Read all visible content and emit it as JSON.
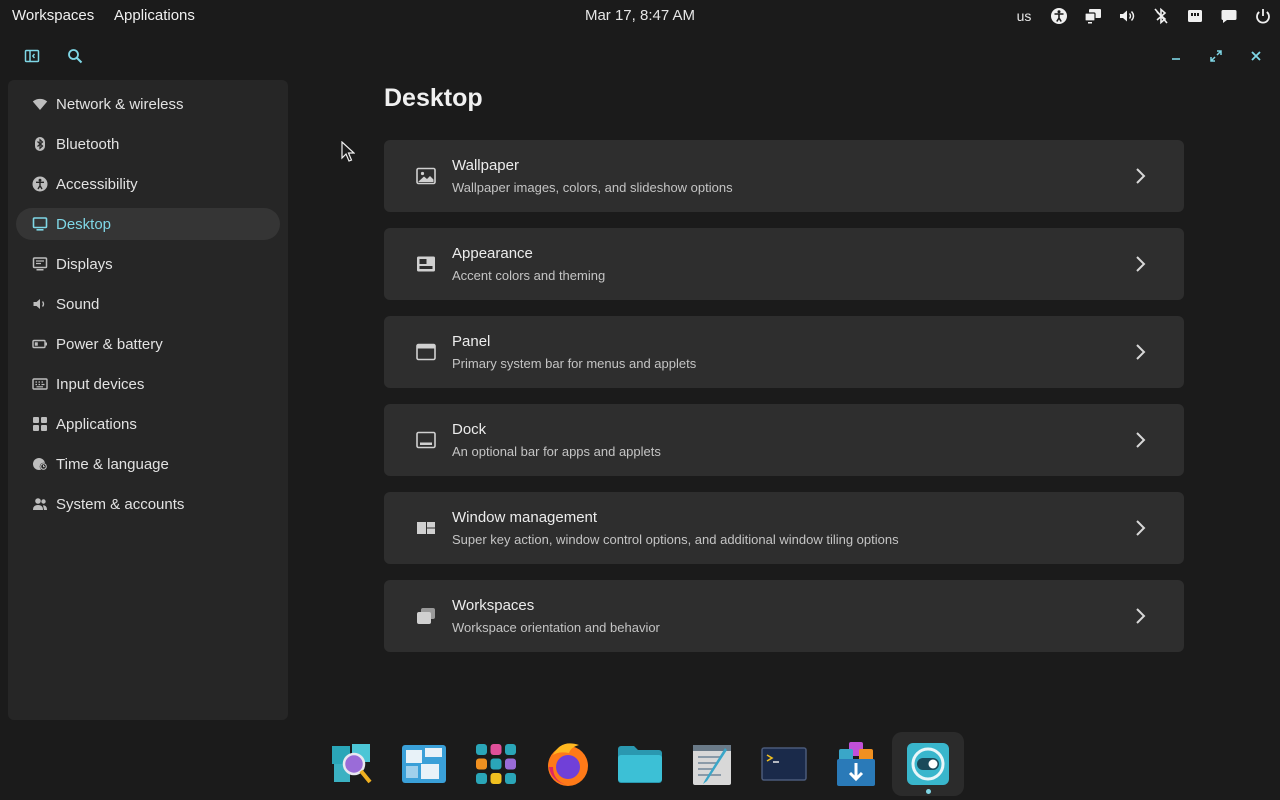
{
  "topbar": {
    "workspaces": "Workspaces",
    "applications": "Applications",
    "clock": "Mar 17, 8:47 AM",
    "keyboard_layout": "us",
    "tray_icons": [
      "accessibility-icon",
      "displays-icon",
      "volume-icon",
      "bluetooth-off-icon",
      "network-icon",
      "notifications-icon",
      "power-icon"
    ]
  },
  "sidebar": {
    "items": [
      {
        "label": "Network & wireless",
        "icon": "wifi-icon"
      },
      {
        "label": "Bluetooth",
        "icon": "bluetooth-icon"
      },
      {
        "label": "Accessibility",
        "icon": "accessibility-icon"
      },
      {
        "label": "Desktop",
        "icon": "desktop-icon",
        "active": true
      },
      {
        "label": "Displays",
        "icon": "display-icon"
      },
      {
        "label": "Sound",
        "icon": "speaker-icon"
      },
      {
        "label": "Power & battery",
        "icon": "battery-icon"
      },
      {
        "label": "Input devices",
        "icon": "keyboard-icon"
      },
      {
        "label": "Applications",
        "icon": "apps-grid-icon"
      },
      {
        "label": "Time & language",
        "icon": "globe-clock-icon"
      },
      {
        "label": "System & accounts",
        "icon": "users-icon"
      }
    ]
  },
  "main": {
    "title": "Desktop",
    "cards": [
      {
        "title": "Wallpaper",
        "desc": "Wallpaper images, colors, and slideshow options",
        "icon": "image-icon"
      },
      {
        "title": "Appearance",
        "desc": "Accent colors and theming",
        "icon": "appearance-icon"
      },
      {
        "title": "Panel",
        "desc": "Primary system bar for menus and applets",
        "icon": "panel-icon"
      },
      {
        "title": "Dock",
        "desc": "An optional bar for apps and applets",
        "icon": "dock-icon"
      },
      {
        "title": "Window management",
        "desc": "Super key action, window control options, and additional window tiling options",
        "icon": "window-management-icon"
      },
      {
        "title": "Workspaces",
        "desc": "Workspace orientation and behavior",
        "icon": "workspaces-icon"
      }
    ]
  },
  "dock": [
    "launcher-icon",
    "workspaces-overview-icon",
    "app-library-icon",
    "firefox-icon",
    "files-icon",
    "text-editor-icon",
    "terminal-icon",
    "store-icon",
    "settings-icon"
  ],
  "colors": {
    "accent": "#7fd7e6",
    "background": "#1b1b1b",
    "sidebar": "#262626",
    "card": "#2e2e2e"
  }
}
